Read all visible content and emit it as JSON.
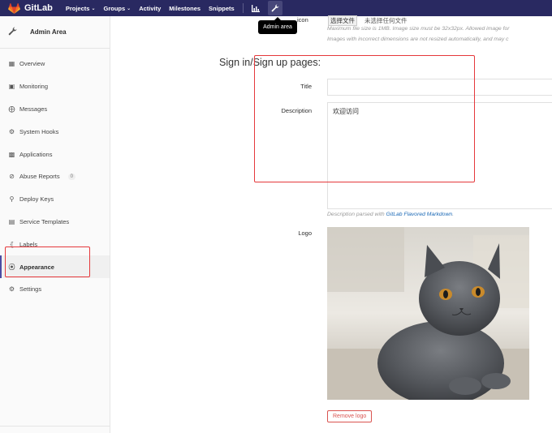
{
  "navbar": {
    "brand": "GitLab",
    "items": [
      {
        "label": "Projects",
        "caret": true
      },
      {
        "label": "Groups",
        "caret": true
      },
      {
        "label": "Activity",
        "caret": false
      },
      {
        "label": "Milestones",
        "caret": false
      },
      {
        "label": "Snippets",
        "caret": false
      }
    ],
    "tooltip": "Admin area"
  },
  "sidebar": {
    "title": "Admin Area",
    "items": [
      {
        "label": "Overview",
        "icon": "grid-icon"
      },
      {
        "label": "Monitoring",
        "icon": "monitor-icon"
      },
      {
        "label": "Messages",
        "icon": "broadcast-icon"
      },
      {
        "label": "System Hooks",
        "icon": "hook-icon"
      },
      {
        "label": "Applications",
        "icon": "apps-icon"
      },
      {
        "label": "Abuse Reports",
        "icon": "abuse-icon",
        "badge": "0"
      },
      {
        "label": "Deploy Keys",
        "icon": "key-icon"
      },
      {
        "label": "Service Templates",
        "icon": "template-icon"
      },
      {
        "label": "Labels",
        "icon": "labels-icon"
      },
      {
        "label": "Appearance",
        "icon": "palette-icon",
        "active": true
      },
      {
        "label": "Settings",
        "icon": "gear-icon"
      }
    ]
  },
  "main": {
    "favicon_label": "icon",
    "file_button": "选择文件",
    "file_none": "未选择任何文件",
    "help1": "Maximum file size is 1MB. Image size must be 32x32px. Allowed image for",
    "help2": "Images with incorrect dimensions are not resized automatically, and may c",
    "section_title": "Sign in/Sign up pages:",
    "title_label": "Title",
    "title_value": "",
    "description_label": "Description",
    "description_value": "欢迎访问",
    "md_help_prefix": "Description parsed with",
    "md_help_link": "GitLab Flavored Markdown",
    "md_help_suffix": ".",
    "logo_label": "Logo",
    "remove_logo": "Remove logo"
  },
  "colors": {
    "navbar": "#292961",
    "annotation": "#e5383b",
    "remove": "#d9534f",
    "link": "#1b69b6"
  }
}
